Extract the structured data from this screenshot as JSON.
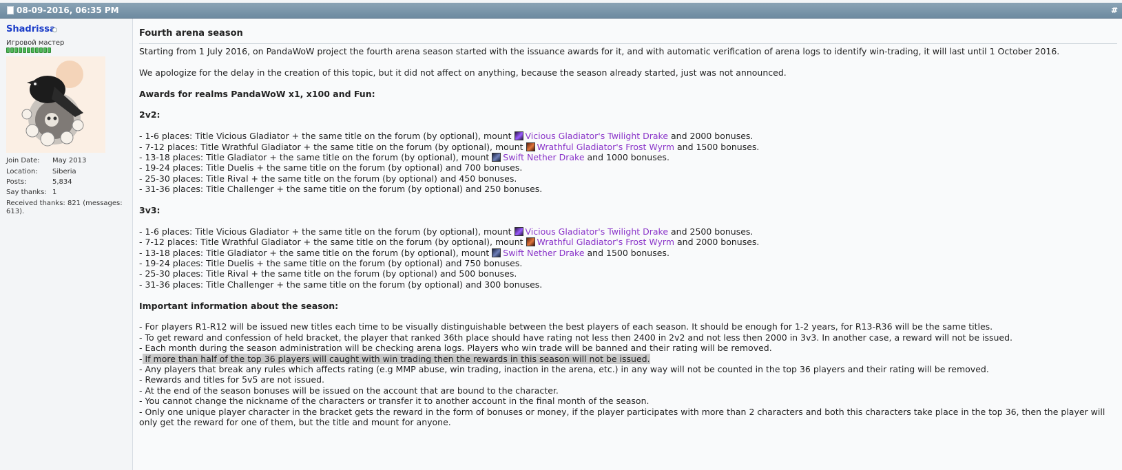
{
  "header": {
    "date": "08-09-2016, 06:35 PM",
    "post_number": "#"
  },
  "user": {
    "name": "Shadrissa",
    "title": "Игровой мастер",
    "join_label": "Join Date:",
    "join_value": "May 2013",
    "location_label": "Location:",
    "location_value": "Siberia",
    "posts_label": "Posts:",
    "posts_value": "5,834",
    "say_label": "Say thanks:",
    "say_value": "1",
    "received": "Received thanks: 821 (messages: 613)."
  },
  "post": {
    "title": "Fourth arena season",
    "intro": "Starting from 1 July 2016, on PandaWoW project the fourth arena season started with the issuance awards for it, and with automatic verification of arena logs to identify win-trading, it will last until 1 October 2016.",
    "apology": "We apologize for the delay in the creation of this topic, but it did not affect on anything, because the season already started, just was not announced.",
    "awards_heading": "Awards for realms PandaWoW x1, x100 and Fun:",
    "two_v_two": "2v2:",
    "three_v_three": "3v3:",
    "mount_drake": "Vicious Gladiator's Twilight Drake",
    "mount_wyrm": "Wrathful Gladiator's Frost Wyrm",
    "mount_nether": "Swift Nether Drake",
    "r2": {
      "l1a": "- 1-6 places: Title Vicious Gladiator + the same title on the forum (by optional), mount ",
      "l1b": " and 2000 bonuses.",
      "l2a": "- 7-12 places: Title Wrathful Gladiator + the same title on the forum (by optional), mount ",
      "l2b": " and 1500 bonuses.",
      "l3a": "- 13-18 places: Title Gladiator + the same title on the forum (by optional), mount ",
      "l3b": " and 1000 bonuses.",
      "l4": "- 19-24 places: Title Duelis + the same title on the forum (by optional) and 700 bonuses.",
      "l5": "- 25-30 places: Title Rival + the same title on the forum (by optional) and 450 bonuses.",
      "l6": "- 31-36 places: Title Challenger + the same title on the forum (by optional) and 250 bonuses."
    },
    "r3": {
      "l1a": "- 1-6 places: Title Vicious Gladiator + the same title on the forum (by optional), mount ",
      "l1b": " and 2500 bonuses.",
      "l2a": "- 7-12 places: Title Wrathful Gladiator + the same title on the forum (by optional), mount ",
      "l2b": " and 2000 bonuses.",
      "l3a": "- 13-18 places: Title Gladiator + the same title on the forum (by optional), mount ",
      "l3b": " and 1500 bonuses.",
      "l4": "- 19-24 places: Title Duelis + the same title on the forum (by optional) and 750 bonuses.",
      "l5": "- 25-30 places: Title Rival + the same title on the forum (by optional) and 500 bonuses.",
      "l6": "- 31-36 places: Title Challenger + the same title on the forum (by optional) and 300 bonuses."
    },
    "important_heading": "Important information about the season:",
    "info": {
      "i1": "- For players R1-R12 will be issued new titles each time to be visually distinguishable between the best players of each season. It should be enough for 1-2 years, for R13-R36 will be the same titles.",
      "i2": "- To get reward and confession of held bracket, the player that ranked 36th place should have rating not less then 2400 in 2v2 and not less then 2000 in 3v3. In another case, a reward will not be issued.",
      "i3": "- Each month during the season administration will be checking arena logs. Players who win trade will be banned and their rating will be removed.",
      "i4_dash": "-",
      "i4": " If more than half of the top 36 players will caught with win trading then the rewards in this season will not be issued.",
      "i5": "- Any players that break any rules which affects rating (e.g MMP abuse, win trading, inaction in the arena, etc.) in any way will not be counted in the top 36 players and their rating will be removed.",
      "i6": "- Rewards and titles for 5v5 are not issued.",
      "i7": "- At the end of the season bonuses will be issued on the account that are bound to the character.",
      "i8": "- You cannot change the nickname of the characters or transfer it to another account in the final month of the season.",
      "i9": "- Only one unique player character in the bracket gets the reward in the form of bonuses or money, if the player participates with more than 2 characters and both this characters take place in the top 36, then the player will only get the reward for one of them, but the title and mount for anyone."
    }
  },
  "colors": {
    "header_bg": "#7891a5",
    "username": "#1a3cc8",
    "mount_link": "#8a35c9",
    "highlight": "#c8c8c8"
  }
}
